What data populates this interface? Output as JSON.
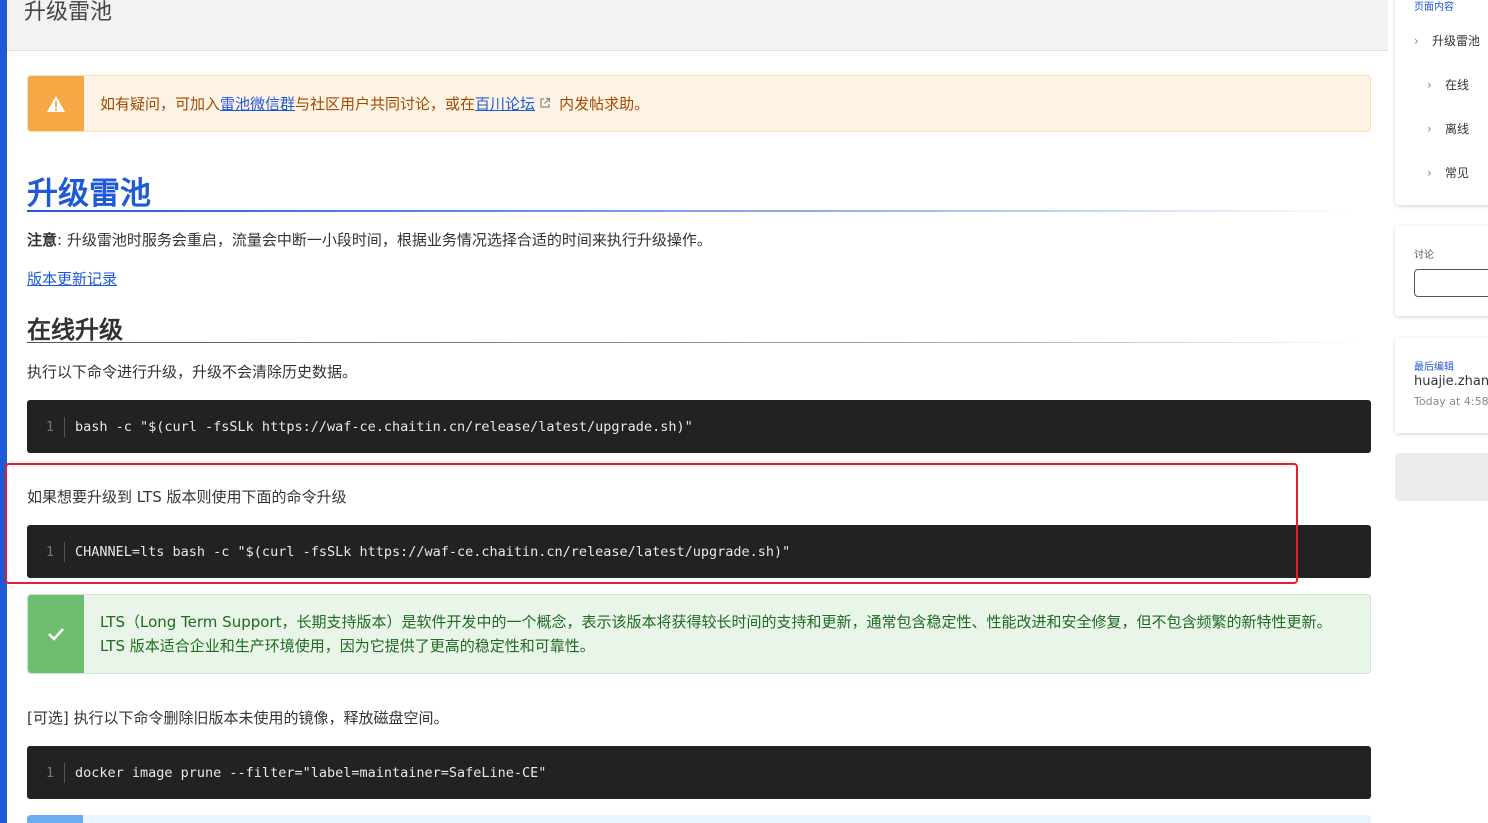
{
  "topbar": {
    "title": "升级雷池"
  },
  "warning": {
    "text_before": "如有疑问，可加入 ",
    "link1": "雷池微信群",
    "text_middle": " 与社区用户共同讨论，或在 ",
    "link2": "百川论坛",
    "text_after": " 内发帖求助。"
  },
  "heading": "升级雷池",
  "note": {
    "label": "注意",
    "text": ": 升级雷池时服务会重启，流量会中断一小段时间，根据业务情况选择合适的时间来执行升级操作。"
  },
  "changelog_link": "版本更新记录",
  "online": {
    "heading": "在线升级",
    "desc": "执行以下命令进行升级，升级不会清除历史数据。",
    "code": {
      "line": "1",
      "cmd": "bash -c \"$(curl -fsSLk https://waf-ce.chaitin.cn/release/latest/upgrade.sh)\""
    },
    "lts_desc": "如果想要升级到 LTS 版本则使用下面的命令升级",
    "lts_code": {
      "line": "1",
      "cmd": "CHANNEL=lts bash -c \"$(curl -fsSLk https://waf-ce.chaitin.cn/release/latest/upgrade.sh)\""
    }
  },
  "lts_note": "LTS（Long Term Support，长期支持版本）是软件开发中的一个概念，表示该版本将获得较长时间的支持和更新，通常包含稳定性、性能改进和安全修复，但不包含频繁的新特性更新。LTS 版本适合企业和生产环境使用，因为它提供了更高的稳定性和可靠性。",
  "optional": {
    "desc": "[可选] 执行以下命令删除旧版本未使用的镜像，释放磁盘空间。",
    "code": {
      "line": "1",
      "cmd": "docker image prune --filter=\"label=maintainer=SafeLine-CE\""
    }
  },
  "sidebar": {
    "toc_title": "页面内容",
    "toc_items": [
      "升级雷池",
      "在线",
      "离线",
      "常见"
    ],
    "discussion_title": "讨论",
    "last_edit_title": "最后编辑",
    "last_edit_user": "huajie.zhan",
    "last_edit_time": "Today at 4:58"
  },
  "colors": {
    "accent": "#1f5ad6",
    "warning": "#f6a845",
    "success": "#6dbf6f",
    "code_bg": "#222222",
    "highlight": "#ea1c2a"
  }
}
